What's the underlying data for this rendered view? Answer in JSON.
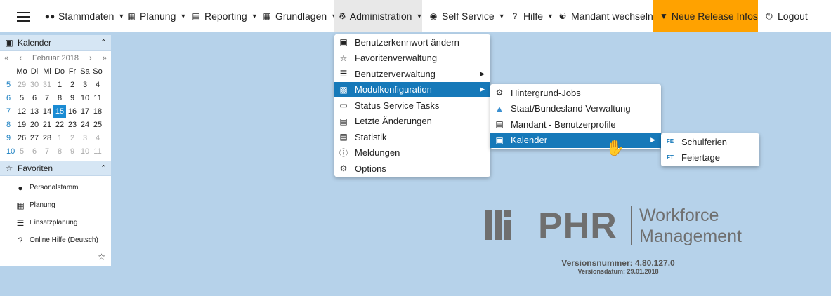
{
  "nav": {
    "items": [
      {
        "label": "Stammdaten",
        "icon": "users-icon"
      },
      {
        "label": "Planung",
        "icon": "calendar-plan-icon"
      },
      {
        "label": "Reporting",
        "icon": "chart-icon"
      },
      {
        "label": "Grundlagen",
        "icon": "grid-icon"
      },
      {
        "label": "Administration",
        "icon": "cogs-icon"
      },
      {
        "label": "Self Service",
        "icon": "user-circle-icon"
      },
      {
        "label": "Hilfe",
        "icon": "question-icon"
      },
      {
        "label": "Mandant wechseln",
        "icon": "sitemap-icon"
      },
      {
        "label": "Neue Release Infos",
        "icon": "shield-icon"
      },
      {
        "label": "Logout",
        "icon": "power-icon"
      }
    ],
    "release_color": "#ffa200"
  },
  "calendar": {
    "title": "Kalender",
    "month": "Februar 2018",
    "weekdays": [
      "Mo",
      "Di",
      "Mi",
      "Do",
      "Fr",
      "Sa",
      "So"
    ],
    "weeks": [
      {
        "nr": "5",
        "days": [
          "29",
          "30",
          "31",
          "1",
          "2",
          "3",
          "4"
        ]
      },
      {
        "nr": "6",
        "days": [
          "5",
          "6",
          "7",
          "8",
          "9",
          "10",
          "11"
        ]
      },
      {
        "nr": "7",
        "days": [
          "12",
          "13",
          "14",
          "15",
          "16",
          "17",
          "18"
        ]
      },
      {
        "nr": "8",
        "days": [
          "19",
          "20",
          "21",
          "22",
          "23",
          "24",
          "25"
        ]
      },
      {
        "nr": "9",
        "days": [
          "26",
          "27",
          "28",
          "1",
          "2",
          "3",
          "4"
        ]
      },
      {
        "nr": "10",
        "days": [
          "5",
          "6",
          "7",
          "8",
          "9",
          "10",
          "11"
        ]
      }
    ],
    "today": "15"
  },
  "favorites": {
    "title": "Favoriten",
    "items": [
      {
        "label": "Personalstamm",
        "icon": "users-icon"
      },
      {
        "label": "Planung",
        "icon": "calendar-plan-icon"
      },
      {
        "label": "Einsatzplanung",
        "icon": "list-icon"
      },
      {
        "label": "Online Hilfe (Deutsch)",
        "icon": "question-icon"
      }
    ]
  },
  "admin_menu": [
    {
      "label": "Benutzerkennwort ändern",
      "icon": "lock-icon"
    },
    {
      "label": "Favoritenverwaltung",
      "icon": "star-icon"
    },
    {
      "label": "Benutzerverwaltung",
      "icon": "user-list-icon"
    },
    {
      "label": "Modulkonfiguration",
      "icon": "module-icon"
    },
    {
      "label": "Status Service Tasks",
      "icon": "monitor-icon"
    },
    {
      "label": "Letzte Änderungen",
      "icon": "document-icon"
    },
    {
      "label": "Statistik",
      "icon": "chart-icon"
    },
    {
      "label": "Meldungen",
      "icon": "alert-icon"
    },
    {
      "label": "Options",
      "icon": "gear-icon"
    }
  ],
  "module_menu": [
    {
      "label": "Hintergrund-Jobs",
      "icon": "gear-icon"
    },
    {
      "label": "Staat/Bundesland Verwaltung",
      "icon": "map-icon"
    },
    {
      "label": "Mandant - Benutzerprofile",
      "icon": "profile-icon"
    },
    {
      "label": "Kalender",
      "icon": "calendar-icon"
    }
  ],
  "calendar_menu": [
    {
      "label": "Schulferien",
      "icon": "fe-icon"
    },
    {
      "label": "Feiertage",
      "icon": "ft-icon"
    }
  ],
  "branding": {
    "name": "PHR",
    "line1": "Workforce",
    "line2": "Management",
    "version": "Versionsnummer: 4.80.127.0",
    "date": "Versionsdatum: 29.01.2018"
  },
  "colors": {
    "background": "#b6d2ea",
    "selected": "#1679b9",
    "today": "#1a8bd3"
  }
}
